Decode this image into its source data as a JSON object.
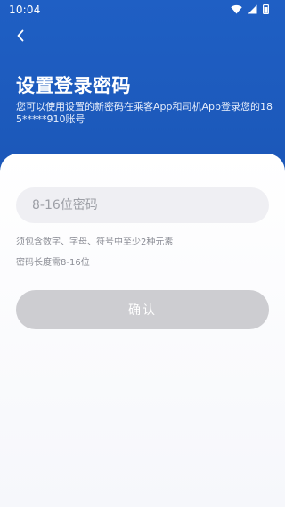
{
  "status_bar": {
    "time": "10:04"
  },
  "header": {
    "title": "设置登录密码",
    "description": "您可以使用设置的新密码在乘客App和司机App登录您的185*****910账号"
  },
  "form": {
    "password_placeholder": "8-16位密码",
    "hints": [
      "须包含数字、字母、符号中至少2种元素",
      "密码长度需8-16位"
    ],
    "confirm_label": "确认"
  },
  "colors": {
    "header_bg": "#1a53b0",
    "input_bg": "#efeff3",
    "button_disabled": "#cdcdd1"
  },
  "icons": {
    "back": "chevron-left-icon",
    "wifi": "wifi-icon",
    "signal": "signal-icon",
    "battery": "battery-icon"
  }
}
